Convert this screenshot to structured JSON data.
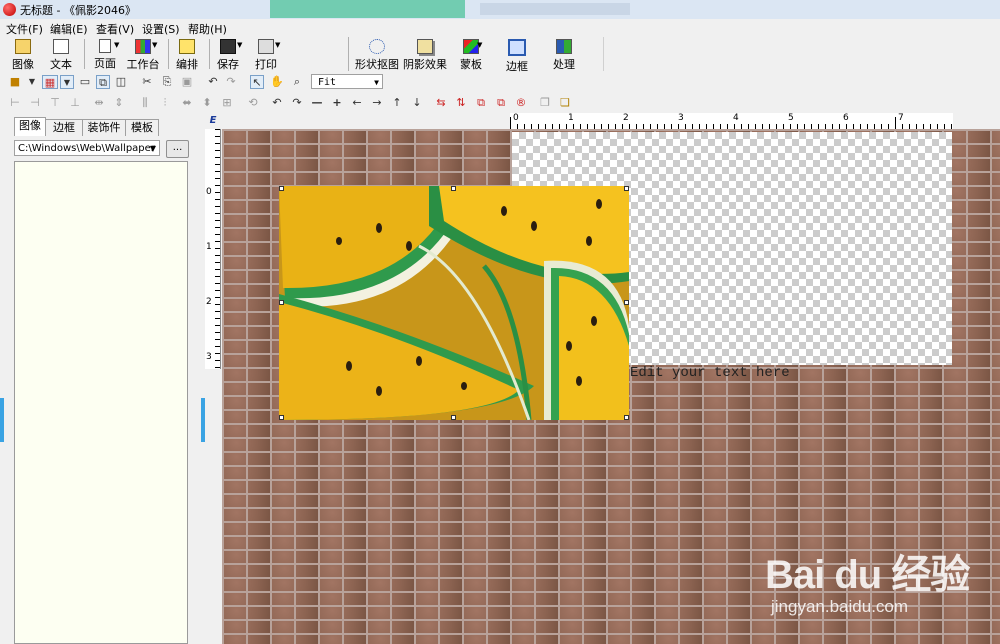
{
  "window": {
    "title": "无标题 - 《佩影2046》"
  },
  "menu": [
    "文件(F)",
    "编辑(E)",
    "查看(V)",
    "设置(S)",
    "帮助(H)"
  ],
  "toolbar": {
    "left": [
      {
        "label": "图像"
      },
      {
        "label": "文本"
      },
      {
        "label": "页面"
      },
      {
        "label": "工作台"
      },
      {
        "label": "编排"
      },
      {
        "label": "保存"
      },
      {
        "label": "打印"
      }
    ],
    "right": [
      {
        "label": "形状抠图"
      },
      {
        "label": "阴影效果"
      },
      {
        "label": "蒙板"
      },
      {
        "label": "边框"
      },
      {
        "label": "处理"
      }
    ]
  },
  "zoom": {
    "value": "Fit"
  },
  "panel": {
    "tabs": [
      "图像",
      "边框",
      "装饰件",
      "模板"
    ],
    "active_tab": "图像",
    "path": "C:\\Windows\\Web\\Wallpaper",
    "browse_label": "..."
  },
  "canvas": {
    "placeholder_text": "Edit your text here"
  },
  "ruler": {
    "horizontal": [
      "0",
      "1",
      "2",
      "3",
      "4",
      "5",
      "6",
      "7"
    ],
    "vertical": [
      "0",
      "1",
      "2",
      "3"
    ],
    "corner": "E"
  },
  "watermark": {
    "logo": "Bai du 经验",
    "url": "jingyan.baidu.com"
  },
  "colors": {
    "accent": "#3aa3e3",
    "panel_bg": "#fdfff2",
    "brick": "#8a6554"
  }
}
